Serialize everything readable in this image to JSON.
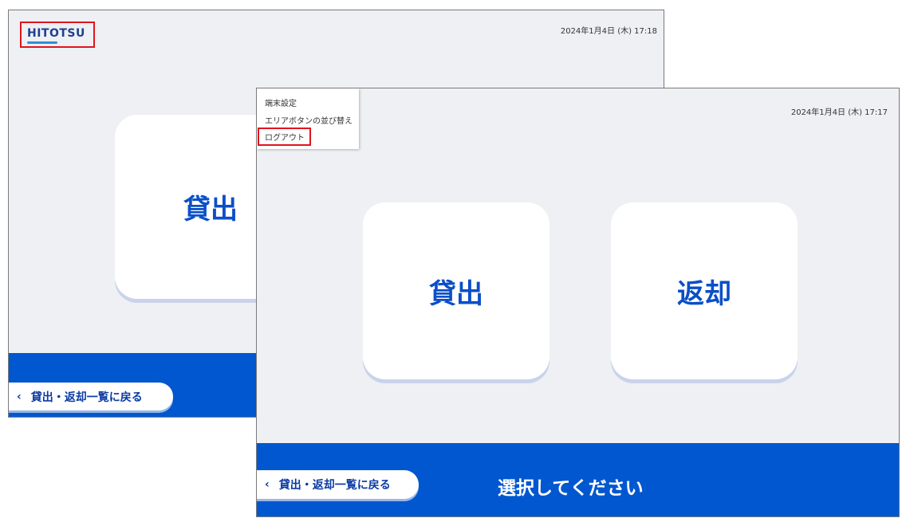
{
  "back_screen": {
    "logo": "HITOTSU",
    "datetime": "2024年1月4日 (木) 17:18",
    "card_lend": "貸出",
    "back_button": "貸出・返却一覧に戻る"
  },
  "front_screen": {
    "datetime": "2024年1月4日 (木) 17:17",
    "menu": {
      "items": [
        "端末設定",
        "エリアボタンの並び替え",
        "ログアウト"
      ]
    },
    "card_lend": "貸出",
    "card_return": "返却",
    "back_button": "貸出・返却一覧に戻る",
    "prompt": "選択してください"
  },
  "colors": {
    "brand_blue": "#0057d0",
    "card_text": "#0a4fc8",
    "highlight_red": "#e0141e",
    "background": "#eef0f4"
  },
  "icons": {
    "back_chevron": "chevron-left-icon",
    "logo_mark": "hitotsu-logo-swoosh"
  }
}
